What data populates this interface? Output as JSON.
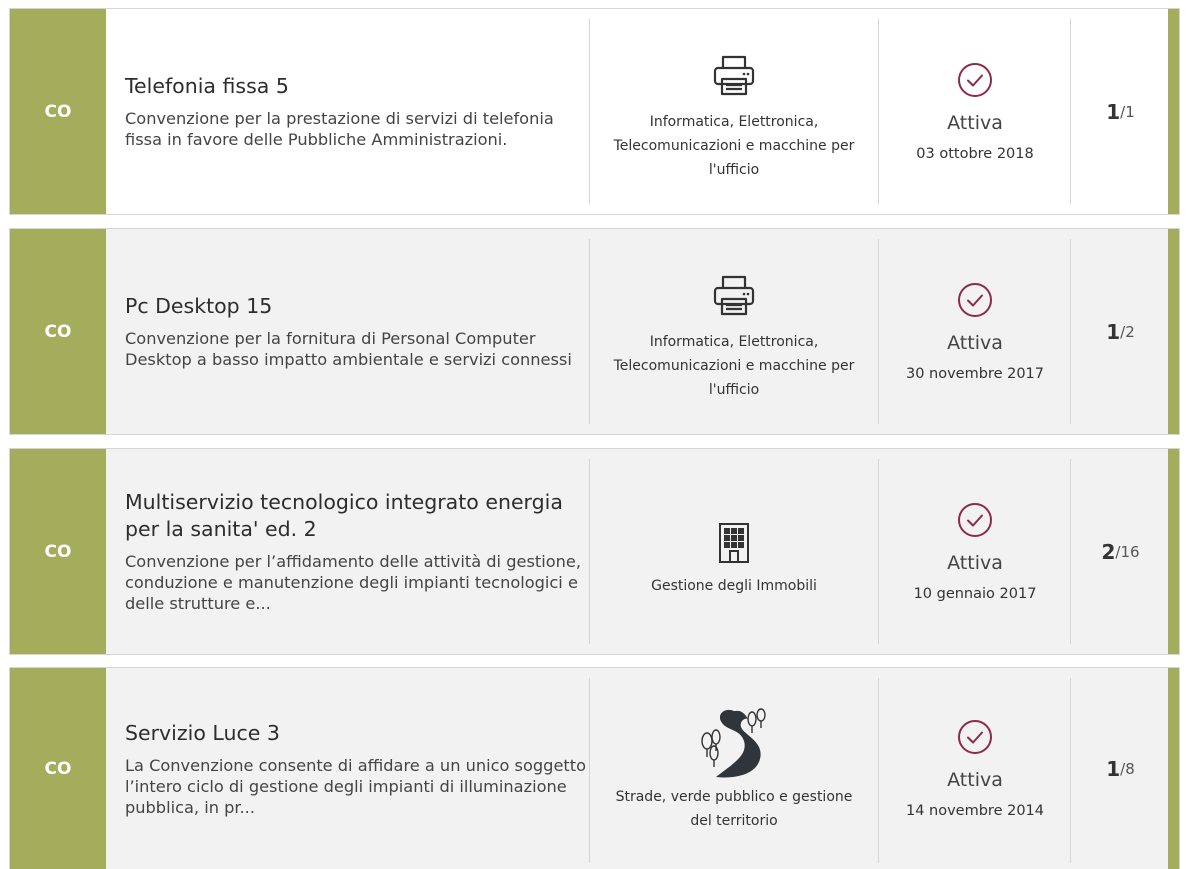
{
  "cards": [
    {
      "badge": "CO",
      "title": "Telefonia fissa 5",
      "description": "Convenzione per la prestazione di servizi di telefonia fissa in favore delle Pubbliche Amministrazioni.",
      "category_icon": "printer-icon",
      "category": "Informatica, Elettronica, Telecomunicazioni e macchine per l'ufficio",
      "status_icon": "check-circle-icon",
      "status": "Attiva",
      "date": "03 ottobre 2018",
      "count_current": "1",
      "count_total": "/1"
    },
    {
      "badge": "CO",
      "title": "Pc Desktop 15",
      "description": "Convenzione per la fornitura di Personal Computer Desktop a basso impatto ambientale e servizi connessi",
      "category_icon": "printer-icon",
      "category": "Informatica, Elettronica, Telecomunicazioni e macchine per l'ufficio",
      "status_icon": "check-circle-icon",
      "status": "Attiva",
      "date": "30 novembre 2017",
      "count_current": "1",
      "count_total": "/2"
    },
    {
      "badge": "CO",
      "title": "Multiservizio tecnologico integrato energia per la sanita' ed. 2",
      "description": "Convenzione per l’affidamento delle attività di gestione, conduzione e manutenzione degli impianti tecnologici e delle strutture e...",
      "category_icon": "building-icon",
      "category": "Gestione degli Immobili",
      "status_icon": "check-circle-icon",
      "status": "Attiva",
      "date": "10 gennaio 2017",
      "count_current": "2",
      "count_total": "/16"
    },
    {
      "badge": "CO",
      "title": "Servizio Luce 3",
      "description": "La Convenzione consente di affidare a un unico soggetto l’intero ciclo di gestione degli impianti di illuminazione pubblica, in pr...",
      "category_icon": "road-trees-icon",
      "category": "Strade, verde pubblico e gestione del territorio",
      "status_icon": "check-circle-icon",
      "status": "Attiva",
      "date": "14 novembre 2014",
      "count_current": "1",
      "count_total": "/8"
    }
  ],
  "colors": {
    "accent": "#a3ad5b",
    "status": "#8b2a4a"
  }
}
